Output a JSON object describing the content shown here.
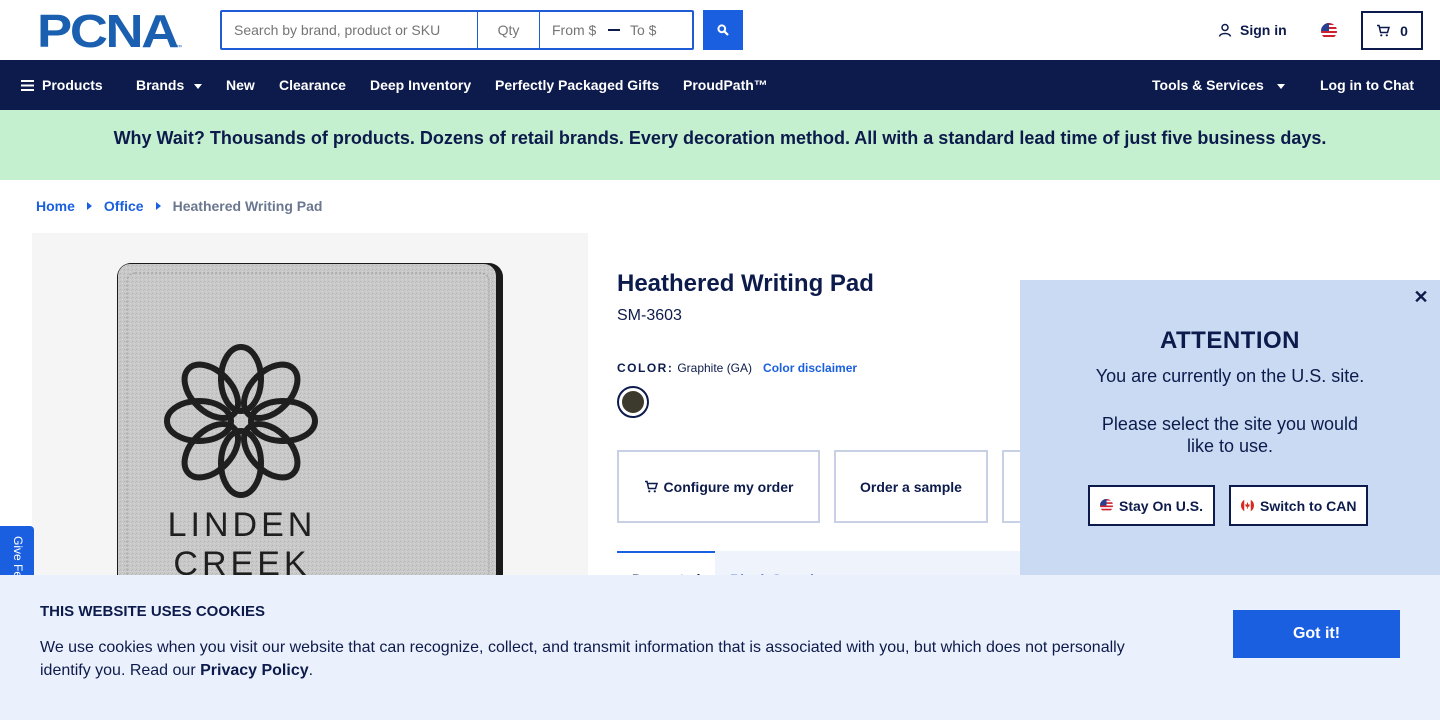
{
  "header": {
    "logo_text": "PCNA",
    "search_placeholder": "Search by brand, product or SKU",
    "qty_placeholder": "Qty",
    "from_placeholder": "From $",
    "to_placeholder": "To $",
    "signin_label": "Sign in",
    "cart_count": "0"
  },
  "nav": {
    "products": "Products",
    "brands": "Brands",
    "new": "New",
    "clearance": "Clearance",
    "deep_inventory": "Deep Inventory",
    "perfectly_packaged_gifts": "Perfectly Packaged Gifts",
    "proudpath": "ProudPath™",
    "tools_services": "Tools & Services",
    "chat": "Log in to Chat"
  },
  "promo": {
    "text": "Why Wait? Thousands of products. Dozens of retail brands. Every decoration method. All with a standard lead time of just five business days."
  },
  "breadcrumb": {
    "home": "Home",
    "office": "Office",
    "current": "Heathered Writing Pad"
  },
  "product": {
    "title": "Heathered Writing Pad",
    "sku": "SM-3603",
    "color_label": "COLOR:",
    "color_value": "Graphite (GA)",
    "color_disclaimer": "Color disclaimer",
    "swatch_color": "#3b3a2c",
    "image_text_line1": "LINDEN",
    "image_text_line2": "CREEK",
    "actions": {
      "configure": "Configure my order",
      "sample": "Order a sample"
    },
    "tabs": {
      "active": "Decorated",
      "other": "Blank Sample"
    }
  },
  "attention": {
    "title": "ATTENTION",
    "line1": "You are currently on the U.S. site.",
    "line2": "Please select the site you would like to use.",
    "stay_us": "Stay On U.S.",
    "switch_can": "Switch to CAN"
  },
  "feedback": {
    "label": "Give Feedback"
  },
  "cookie": {
    "title": "THIS WEBSITE USES COOKIES",
    "text": "We use cookies when you visit our website that can recognize, collect, and transmit information that is associated with you, but which does not personally identify you. Read our ",
    "link": "Privacy Policy",
    "period": ".",
    "button": "Got it!"
  },
  "colors": {
    "navy": "#0d1b4c",
    "blue": "#1a5fe0",
    "promo_bg": "#c4f0cf",
    "popup_bg": "#c9daf2",
    "cookie_bg": "#ebf1fc"
  }
}
